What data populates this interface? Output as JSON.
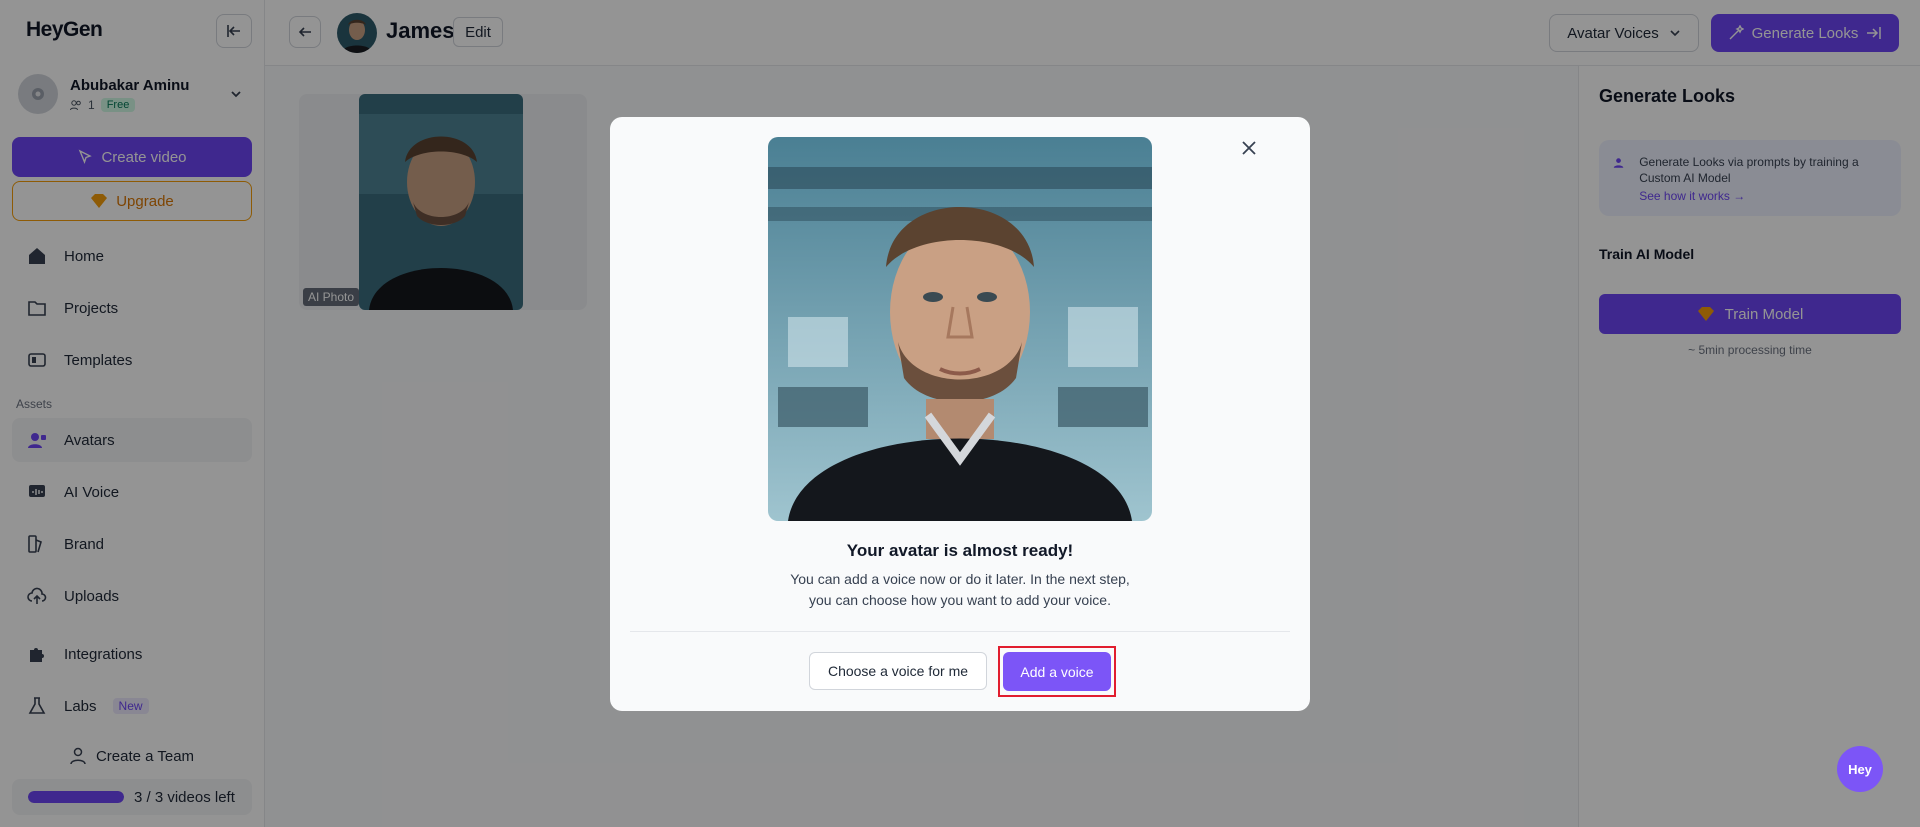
{
  "sidebar": {
    "logo": "HeyGen",
    "user": {
      "name": "Abubakar Aminu",
      "member_count": "1",
      "plan": "Free"
    },
    "create_video": "Create video",
    "upgrade": "Upgrade",
    "nav": [
      {
        "label": "Home",
        "icon": "home-icon"
      },
      {
        "label": "Projects",
        "icon": "folder-icon"
      },
      {
        "label": "Templates",
        "icon": "templates-icon"
      }
    ],
    "assets_label": "Assets",
    "assets": [
      {
        "label": "Avatars",
        "icon": "avatar-icon"
      },
      {
        "label": "AI Voice",
        "icon": "voice-icon"
      },
      {
        "label": "Brand",
        "icon": "brand-icon"
      },
      {
        "label": "Uploads",
        "icon": "upload-icon"
      }
    ],
    "integrations": "Integrations",
    "labs": "Labs",
    "labs_badge": "New",
    "create_team": "Create a Team",
    "quota": {
      "text": "3 / 3 videos left",
      "fraction": 1.0
    }
  },
  "topbar": {
    "title": "James",
    "edit": "Edit",
    "avatar_voices": "Avatar Voices",
    "generate_looks": "Generate Looks"
  },
  "main": {
    "photo_tag": "AI Photo"
  },
  "right_panel": {
    "title": "Generate Looks",
    "info": "Generate Looks via prompts by training a Custom AI Model",
    "info_link": "See how it works →",
    "subtitle": "Train AI Model",
    "train_button": "Train Model",
    "note": "~ 5min processing time"
  },
  "modal": {
    "title": "Your avatar is almost ready!",
    "line1": "You can add a voice now or do it later. In the next step,",
    "line2": "you can choose how you want to add your voice.",
    "choose_button": "Choose a voice for me",
    "add_button": "Add a voice"
  },
  "help_bubble": "Hey",
  "colors": {
    "accent": "#6d45f5",
    "highlight": "#e11d2e",
    "upgrade": "#f59e0b"
  }
}
